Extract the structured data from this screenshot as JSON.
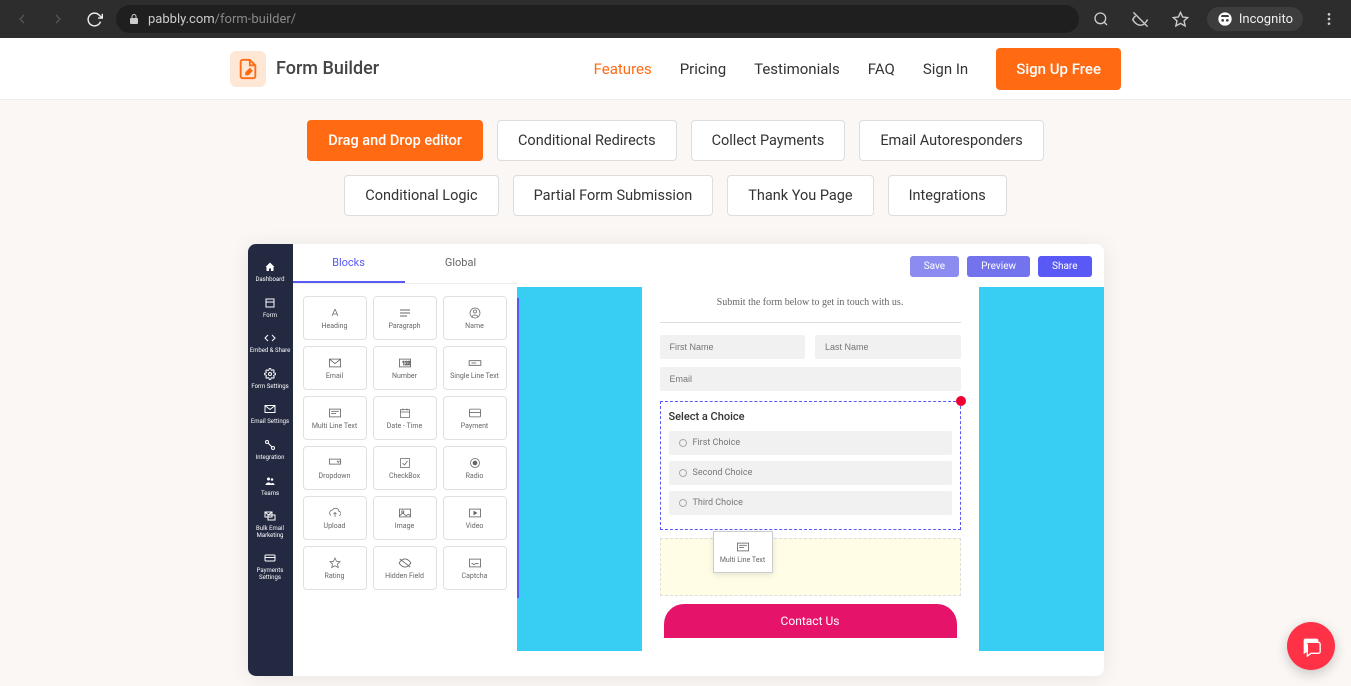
{
  "browser": {
    "url_host": "pabbly.com",
    "url_path": "/form-builder/",
    "incognito_label": "Incognito"
  },
  "header": {
    "brand": "Form Builder",
    "nav": {
      "features": "Features",
      "pricing": "Pricing",
      "testimonials": "Testimonials",
      "faq": "FAQ",
      "signin": "Sign In",
      "signup": "Sign Up Free"
    }
  },
  "feature_tabs": [
    "Drag and Drop editor",
    "Conditional Redirects",
    "Collect Payments",
    "Email Autoresponders",
    "Conditional Logic",
    "Partial Form Submission",
    "Thank You Page",
    "Integrations"
  ],
  "sidebar": [
    "Dashboard",
    "Form",
    "Embed & Share",
    "Form Settings",
    "Email Settings",
    "Integration",
    "Teams",
    "Bulk Email Marketing",
    "Payments Settings"
  ],
  "panel_tabs": {
    "blocks": "Blocks",
    "global": "Global"
  },
  "blocks": [
    "Heading",
    "Paragraph",
    "Name",
    "Email",
    "Number",
    "Single Line Text",
    "Multi Line Text",
    "Date - Time",
    "Payment",
    "Dropdown",
    "CheckBox",
    "Radio",
    "Upload",
    "Image",
    "Video",
    "Rating",
    "Hidden Field",
    "Captcha"
  ],
  "canvas_actions": {
    "save": "Save",
    "preview": "Preview",
    "share": "Share"
  },
  "form": {
    "subtitle": "Submit the form below to get in touch with us.",
    "first_name_ph": "First Name",
    "last_name_ph": "Last Name",
    "email_ph": "Email",
    "choice_title": "Select a Choice",
    "choices": [
      "First Choice",
      "Second Choice",
      "Third Choice"
    ],
    "submit": "Contact Us",
    "dragging": "Multi Line Text"
  }
}
